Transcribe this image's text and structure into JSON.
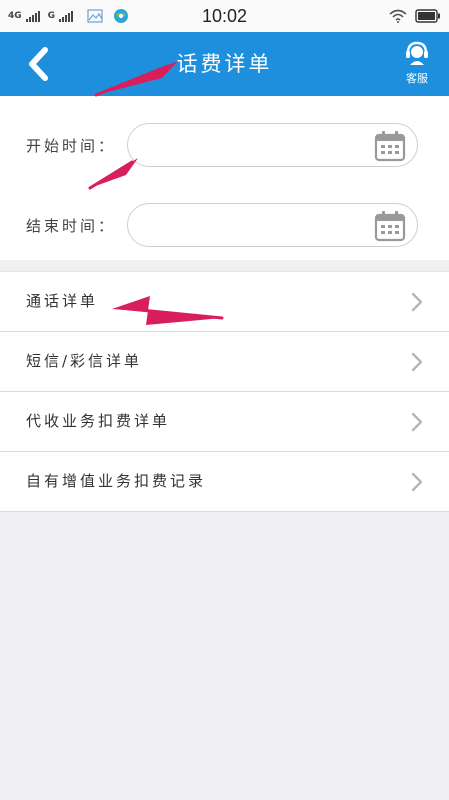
{
  "status_bar": {
    "net1": "4G",
    "net2": "G",
    "time": "10:02"
  },
  "header": {
    "title": "话费详单",
    "service_label": "客服"
  },
  "date_filter": {
    "start_label": "开始时间：",
    "end_label": "结束时间：",
    "start_value": "",
    "end_value": ""
  },
  "list": {
    "items": [
      {
        "label": "通话详单"
      },
      {
        "label": "短信/彩信详单"
      },
      {
        "label": "代收业务扣费详单"
      },
      {
        "label": "自有增值业务扣费记录"
      }
    ]
  },
  "colors": {
    "header_bg": "#1e8fdd",
    "annotation_arrow": "#d81e5b"
  },
  "icons": [
    "back-chevron-icon",
    "customer-service-icon",
    "calendar-icon",
    "chevron-right-icon",
    "wifi-icon",
    "battery-icon",
    "signal-icon"
  ]
}
